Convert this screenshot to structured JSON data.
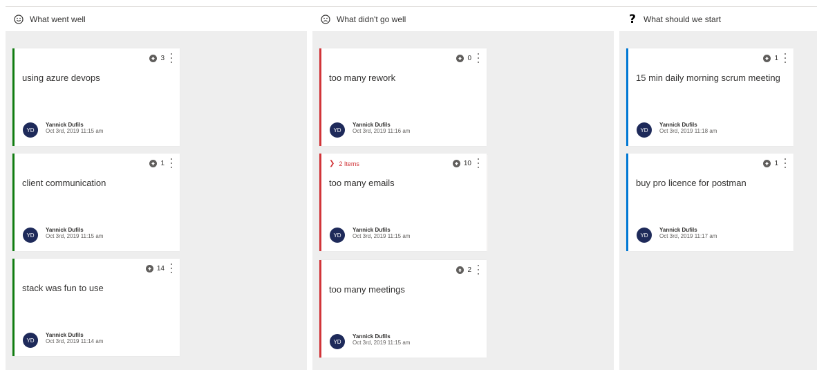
{
  "columns": [
    {
      "title": "What went well",
      "icon": "smile-icon",
      "accent": "#107c10",
      "cards": [
        {
          "votes": "3",
          "text": "using azure devops",
          "initials": "YD",
          "author": "Yannick Dufils",
          "date": "Oct 3rd, 2019 11:15 am"
        },
        {
          "votes": "1",
          "text": "client communication",
          "initials": "YD",
          "author": "Yannick Dufils",
          "date": "Oct 3rd, 2019 11:15 am"
        },
        {
          "votes": "14",
          "text": "stack was fun to use",
          "initials": "YD",
          "author": "Yannick Dufils",
          "date": "Oct 3rd, 2019 11:14 am"
        }
      ]
    },
    {
      "title": "What didn't go well",
      "icon": "frown-icon",
      "accent": "#d13438",
      "cards": [
        {
          "votes": "0",
          "text": "too many rework",
          "initials": "YD",
          "author": "Yannick Dufils",
          "date": "Oct 3rd, 2019 11:16 am"
        },
        {
          "votes": "10",
          "group_label": "2 Items",
          "text": "too many emails",
          "initials": "YD",
          "author": "Yannick Dufils",
          "date": "Oct 3rd, 2019 11:15 am"
        },
        {
          "votes": "2",
          "text": "too many meetings",
          "initials": "YD",
          "author": "Yannick Dufils",
          "date": "Oct 3rd, 2019 11:15 am"
        }
      ]
    },
    {
      "title": "What should we start",
      "icon": "question-mark-icon",
      "accent": "#0078d4",
      "cards": [
        {
          "votes": "1",
          "text": "15 min daily morning scrum meeting",
          "initials": "YD",
          "author": "Yannick Dufils",
          "date": "Oct 3rd, 2019 11:18 am"
        },
        {
          "votes": "1",
          "text": "buy pro licence for postman",
          "initials": "YD",
          "author": "Yannick Dufils",
          "date": "Oct 3rd, 2019 11:17 am"
        }
      ]
    }
  ]
}
